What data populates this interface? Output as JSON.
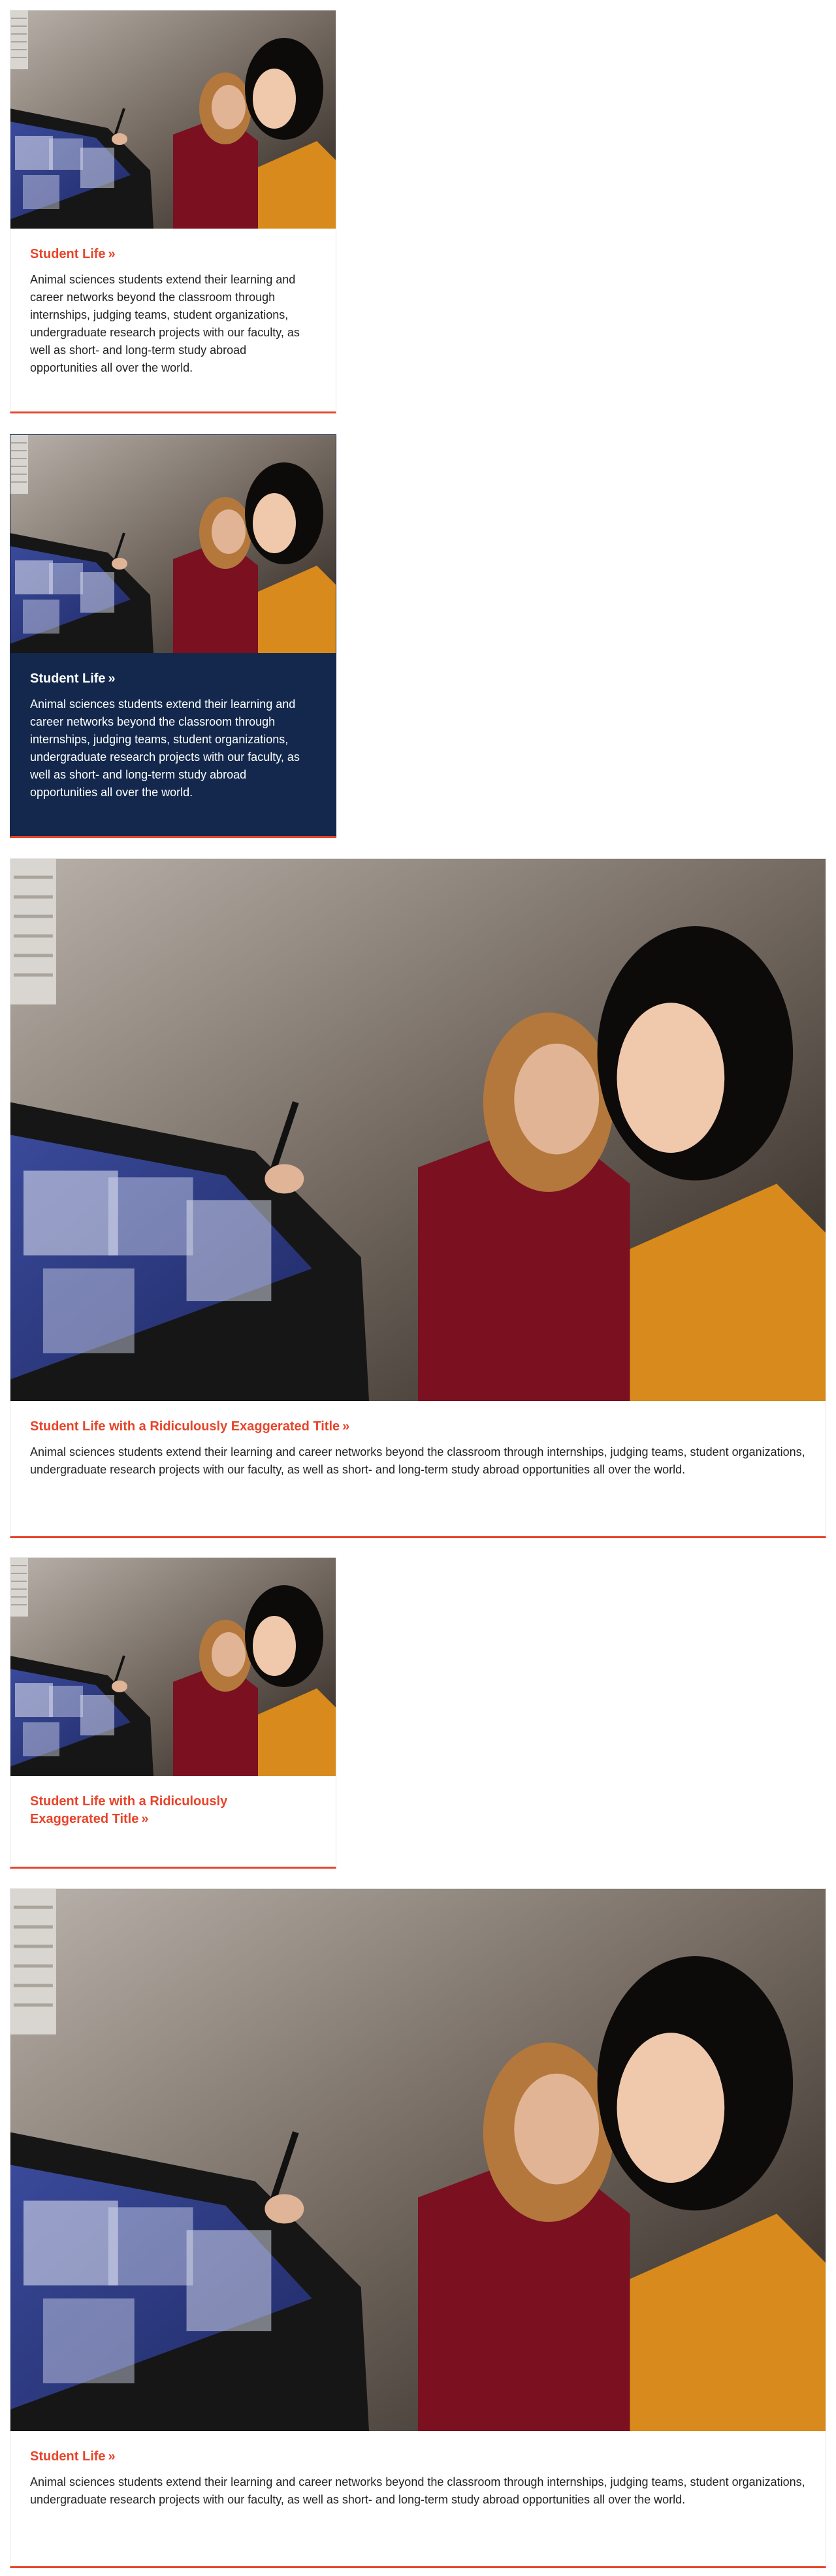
{
  "cards": [
    {
      "title": "Student Life",
      "description": "Animal sciences students extend their learning and career networks beyond the classroom through internships, judging teams, student organizations, undergraduate research projects with our faculty, as well as short- and long-term study abroad opportunities all over the world.",
      "chevron": "»",
      "variant": "light"
    },
    {
      "title": "Student Life",
      "description": "Animal sciences students extend their learning and career networks beyond the classroom through internships, judging teams, student organizations, undergraduate research projects with our faculty, as well as short- and long-term study abroad opportunities all over the world.",
      "chevron": "»",
      "variant": "dark"
    },
    {
      "title": "Student Life with a Ridiculously Exaggerated Title",
      "description": "Animal sciences students extend their learning and career networks beyond the classroom through internships, judging teams, student organizations, undergraduate research projects with our faculty, as well as short- and long-term study abroad opportunities all over the world.",
      "chevron": "»",
      "variant": "light"
    },
    {
      "title": "Student Life with a Ridiculously Exaggerated Title",
      "chevron": "»",
      "variant": "light"
    },
    {
      "title": "Student Life",
      "description": "Animal sciences students extend their learning and career networks beyond the classroom through internships, judging teams, student organizations, undergraduate research projects with our faculty, as well as short- and long-term study abroad opportunities all over the world.",
      "chevron": "»",
      "variant": "light"
    }
  ],
  "colors": {
    "accent": "#e8442a",
    "dark_panel": "#13284c",
    "text": "#222222"
  },
  "image_icon": "photo-two-students-at-scan-monitor"
}
